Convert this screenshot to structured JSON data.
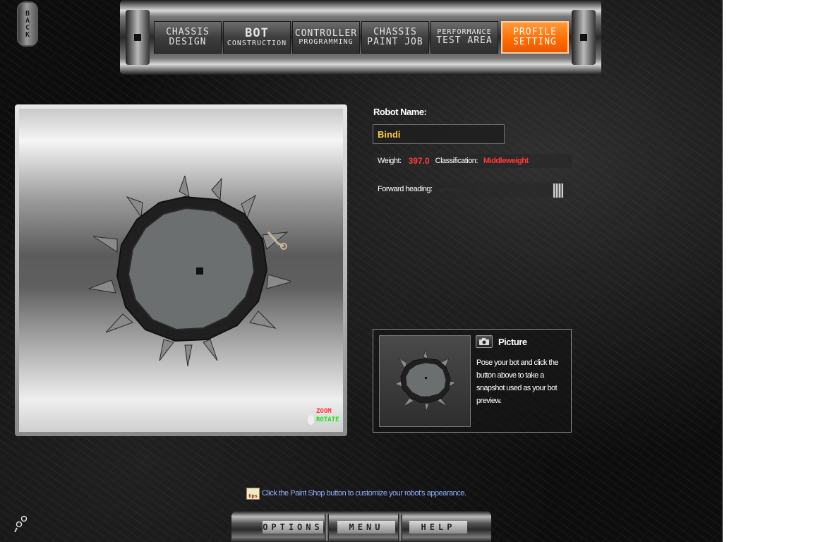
{
  "back_button": {
    "label": "BACK"
  },
  "nav": {
    "tabs": [
      {
        "line1": "CHASSIS",
        "line2": "DESIGN",
        "active": false
      },
      {
        "line1": "BOT",
        "line2": "CONSTRUCTION",
        "active": false
      },
      {
        "line1": "CONTROLLER",
        "line2": "PROGRAMMING",
        "active": false
      },
      {
        "line1": "CHASSIS",
        "line2": "PAINT JOB",
        "active": false
      },
      {
        "line1": "PERFORMANCE",
        "line2": "TEST AREA",
        "active": false
      },
      {
        "line1": "PROFILE",
        "line2": "SETTING",
        "active": true
      }
    ]
  },
  "viewport": {
    "zoom_label": "ZOOM",
    "rotate_label": "ROTATE"
  },
  "properties": {
    "robot_name_label": "Robot Name:",
    "robot_name_value": "Bindi",
    "weight_label": "Weight:",
    "weight_value": "397.0",
    "classification_label": "Classification:",
    "classification_value": "Middleweight",
    "forward_heading_label": "Forward heading:",
    "forward_heading_fraction": 0.92
  },
  "picture": {
    "title": "Picture",
    "description": "Pose your bot and click the button above to take a snapshot used as your bot preview."
  },
  "tip": {
    "icon_text": "tips",
    "text": "Click the Paint Shop button to customize your robot's appearance."
  },
  "bottom_menu": {
    "options_label": "OPTIONS",
    "menu_label": "MENU",
    "help_label": "HELP"
  },
  "colors": {
    "accent_orange": "#ff6a00",
    "value_red": "#ff3b3b",
    "name_gold": "#ffc94a",
    "tip_blue": "#8fb0ff"
  }
}
